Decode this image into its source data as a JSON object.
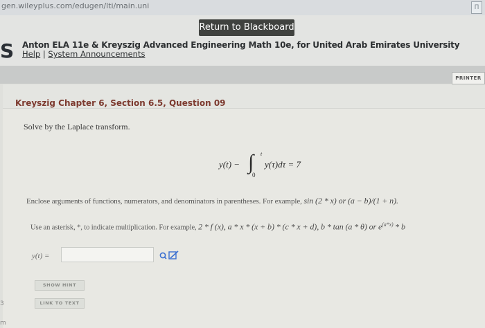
{
  "browser": {
    "url": "gen.wileyplus.com/edugen/lti/main.uni",
    "corner_badge": "Π"
  },
  "header": {
    "return_button": "Return to Blackboard",
    "logo_letter": "S",
    "course_title": "Anton ELA 11e & Kreyszig Advanced Engineering Math 10e, for United Arab Emirates University",
    "help_link": "Help",
    "separator": "|",
    "announcements_link": "System Announcements"
  },
  "toolbar": {
    "printer_button": "PRINTER"
  },
  "question": {
    "title": "Kreyszig Chapter 6, Section 6.5, Question 09",
    "prompt": "Solve by the Laplace transform.",
    "equation": {
      "lhs": "y(t) −",
      "upper_limit": "t",
      "lower_limit": "0",
      "integrand": "y(τ)dτ = 7"
    },
    "instruction_1_text": "Enclose arguments of functions, numerators, and denominators in parentheses. For example,",
    "instruction_1_example": "sin (2 * x) or (a − b)/(1 + n).",
    "instruction_2_text": "Use an asterisk, *, to indicate multiplication. For example,",
    "instruction_2_example": "2 * f (x), a * x * (x + b) * (c * x + d), b * tan (a * θ) or e",
    "instruction_2_sup": "(a*x)",
    "instruction_2_tail": "* b",
    "answer_label": "y(t) =",
    "answer_value": "",
    "show_hint": "SHOW HINT",
    "link_to_text": "LINK TO TEXT"
  },
  "edge_marks": [
    "3",
    "m"
  ],
  "colors": {
    "accent_title": "#7d3a2f",
    "return_button_bg": "#40423f",
    "tools_icon": "#3a6fd1"
  }
}
